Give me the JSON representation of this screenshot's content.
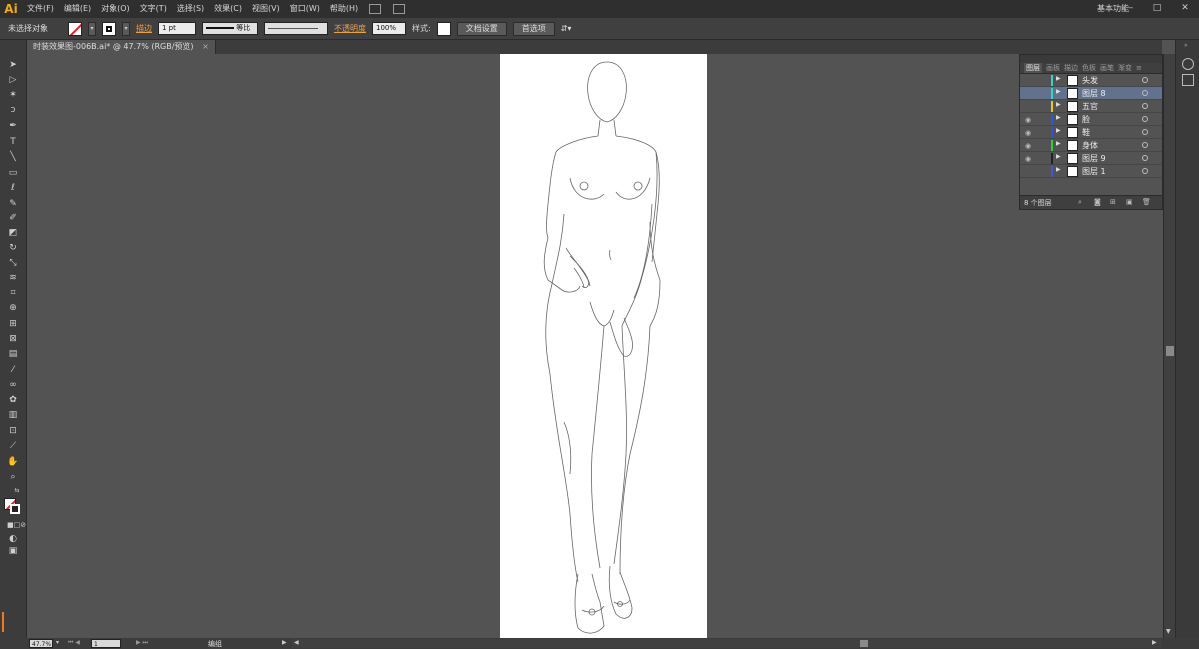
{
  "app": {
    "logo": "Ai",
    "workspace": "基本功能"
  },
  "menu": [
    "文件(F)",
    "编辑(E)",
    "对象(O)",
    "文字(T)",
    "选择(S)",
    "效果(C)",
    "视图(V)",
    "窗口(W)",
    "帮助(H)"
  ],
  "control_bar": {
    "selection": "未选择对象",
    "stroke_label": "描边",
    "stroke_weight": "1 pt",
    "stroke_profile": "等比",
    "opacity_label": "不透明度",
    "opacity_value": "100%",
    "style_label": "样式:",
    "doc_setup": "文档设置",
    "preferences": "首选项"
  },
  "document": {
    "tab": "时装效果图-006B.ai* @ 47.7% (RGB/预览)",
    "close": "×"
  },
  "status": {
    "zoom": "47.7%",
    "page": "1",
    "mode": "编组"
  },
  "layers_panel": {
    "tabs": [
      "图层",
      "画板",
      "描边",
      "色板",
      "画笔",
      "渐变"
    ],
    "layers": [
      {
        "name": "头发",
        "color": "#3ad1c7",
        "visible": false,
        "selected": false
      },
      {
        "name": "图层 8",
        "color": "#3ad1c7",
        "visible": false,
        "selected": true
      },
      {
        "name": "五官",
        "color": "#e6c72a",
        "visible": false,
        "selected": false
      },
      {
        "name": "脸",
        "color": "#2a5ad6",
        "visible": true,
        "selected": false
      },
      {
        "name": "鞋",
        "color": "#3a4bd6",
        "visible": true,
        "selected": false
      },
      {
        "name": "身体",
        "color": "#2ad13a",
        "visible": true,
        "selected": false
      },
      {
        "name": "图层 9",
        "color": "#222222",
        "visible": true,
        "selected": false
      },
      {
        "name": "图层 1",
        "color": "#3a5ad6",
        "visible": false,
        "selected": false
      }
    ],
    "count": "8 个图层"
  }
}
